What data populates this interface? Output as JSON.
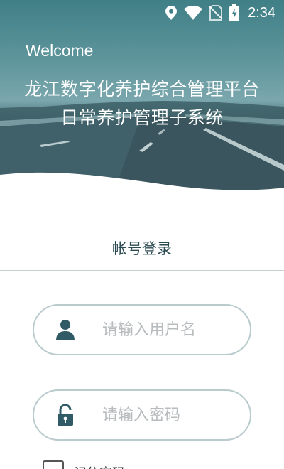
{
  "status_bar": {
    "time": "2:34",
    "icons": [
      "location-icon",
      "wifi-icon",
      "no-sim-icon",
      "battery-charging-icon"
    ]
  },
  "header": {
    "welcome": "Welcome",
    "title_line1": "龙江数字化养护综合管理平台",
    "title_line2": "日常养护管理子系统"
  },
  "login": {
    "tab_label": "帐号登录",
    "username": {
      "value": "",
      "placeholder": "请输入用户名",
      "icon": "user-icon"
    },
    "password": {
      "value": "",
      "placeholder": "请输入密码",
      "icon": "lock-icon"
    },
    "remember_label": "记住密码"
  },
  "colors": {
    "accent": "#2f5a66",
    "field_border": "#b9cbcd",
    "placeholder": "#b8bcbe",
    "title_text": "#2c4a52"
  }
}
